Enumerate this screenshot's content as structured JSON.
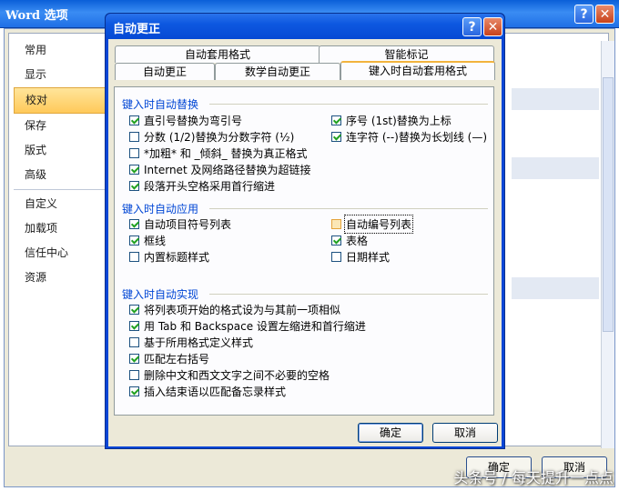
{
  "outer_window": {
    "title": "Word 选项",
    "help_glyph": "?",
    "close_glyph": "✕",
    "sidebar": [
      {
        "label": "常用",
        "active": false
      },
      {
        "label": "显示",
        "active": false
      },
      {
        "label": "校对",
        "active": true
      },
      {
        "label": "保存",
        "active": false
      },
      {
        "label": "版式",
        "active": false
      },
      {
        "label": "高级",
        "active": false
      },
      {
        "label": "自定义",
        "active": false
      },
      {
        "label": "加载项",
        "active": false
      },
      {
        "label": "信任中心",
        "active": false
      },
      {
        "label": "资源",
        "active": false
      }
    ],
    "ok_label": "确定",
    "cancel_label": "取消"
  },
  "dialog": {
    "title": "自动更正",
    "help_glyph": "?",
    "close_glyph": "✕",
    "tabs_row1": [
      "自动套用格式",
      "智能标记"
    ],
    "tabs_row2": [
      "自动更正",
      "数学自动更正",
      "键入时自动套用格式"
    ],
    "active_tab": "键入时自动套用格式",
    "groups": {
      "replace": {
        "title": "键入时自动替换",
        "items": [
          {
            "label": "直引号替换为弯引号",
            "checked": true
          },
          {
            "label": "序号 (1st)替换为上标",
            "checked": true
          },
          {
            "label": "分数 (1/2)替换为分数字符 (½)",
            "checked": false
          },
          {
            "label": "连字符 (--)替换为长划线 (—)",
            "checked": true
          },
          {
            "label": "*加粗* 和 _倾斜_ 替换为真正格式",
            "checked": false
          },
          {
            "label": "Internet 及网络路径替换为超链接",
            "checked": true
          },
          {
            "label": "段落开头空格采用首行缩进",
            "checked": true
          }
        ]
      },
      "apply": {
        "title": "键入时自动应用",
        "items": [
          {
            "label": "自动项目符号列表",
            "checked": true
          },
          {
            "label": "自动编号列表",
            "checked": false
          },
          {
            "label": "框线",
            "checked": true
          },
          {
            "label": "表格",
            "checked": true
          },
          {
            "label": "内置标题样式",
            "checked": false
          },
          {
            "label": "日期样式",
            "checked": false
          }
        ]
      },
      "auto": {
        "title": "键入时自动实现",
        "items": [
          {
            "label": "将列表项开始的格式设为与其前一项相似",
            "checked": true
          },
          {
            "label": "用 Tab 和 Backspace 设置左缩进和首行缩进",
            "checked": true
          },
          {
            "label": "基于所用格式定义样式",
            "checked": false
          },
          {
            "label": "匹配左右括号",
            "checked": true
          },
          {
            "label": "删除中文和西文文字之间不必要的空格",
            "checked": false
          },
          {
            "label": "插入结束语以匹配备忘录样式",
            "checked": true
          }
        ]
      }
    },
    "ok_label": "确定",
    "cancel_label": "取消"
  },
  "watermark": "头条号 / 每天提升一点点",
  "colors": {
    "group_title": "#0046d5",
    "title_bar": "#0a46d5",
    "check": "#21a121"
  }
}
